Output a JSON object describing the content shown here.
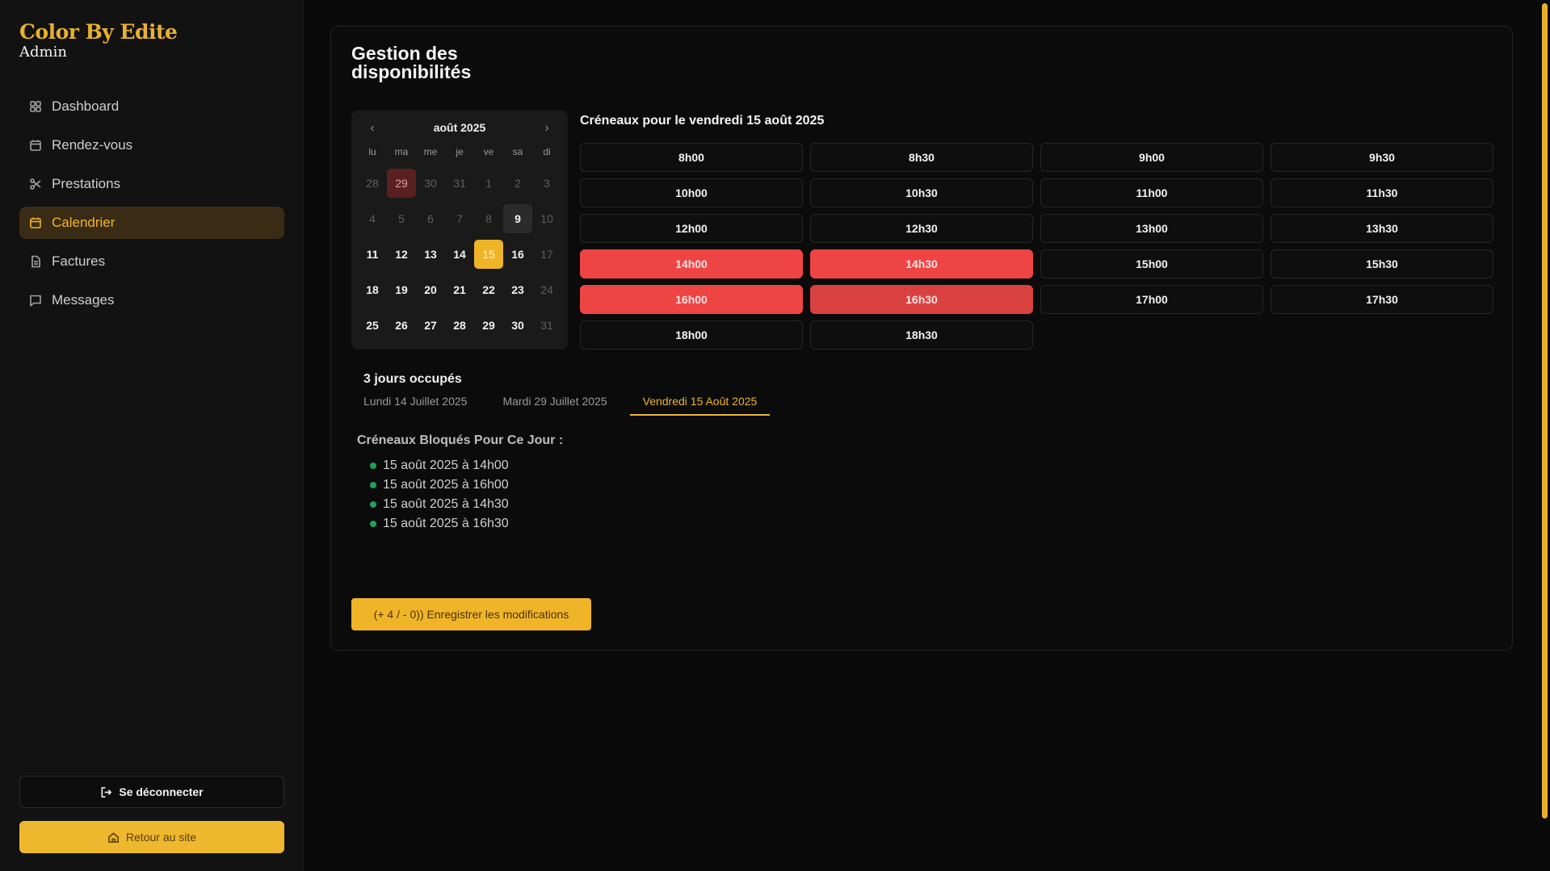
{
  "brand": {
    "title": "Color By Edite",
    "subtitle": "Admin"
  },
  "nav": {
    "items": [
      {
        "label": "Dashboard",
        "icon": "grid-icon"
      },
      {
        "label": "Rendez-vous",
        "icon": "calendar-icon"
      },
      {
        "label": "Prestations",
        "icon": "scissors-icon"
      },
      {
        "label": "Calendrier",
        "icon": "calendar-icon",
        "active": true
      },
      {
        "label": "Factures",
        "icon": "file-icon"
      },
      {
        "label": "Messages",
        "icon": "message-icon"
      }
    ]
  },
  "sidebar_actions": {
    "logout": "Se déconnecter",
    "home": "Retour au site"
  },
  "page": {
    "title": "Gestion des disponibilités"
  },
  "calendar": {
    "month": "août 2025",
    "prev": "‹",
    "next": "›",
    "weekdays": [
      "lu",
      "ma",
      "me",
      "je",
      "ve",
      "sa",
      "di"
    ],
    "days": [
      {
        "d": "28",
        "s": "muted"
      },
      {
        "d": "29",
        "s": "busy"
      },
      {
        "d": "30",
        "s": "muted"
      },
      {
        "d": "31",
        "s": "muted"
      },
      {
        "d": "1",
        "s": "muted"
      },
      {
        "d": "2",
        "s": "muted"
      },
      {
        "d": "3",
        "s": "muted"
      },
      {
        "d": "4",
        "s": "muted"
      },
      {
        "d": "5",
        "s": "muted"
      },
      {
        "d": "6",
        "s": "muted"
      },
      {
        "d": "7",
        "s": "muted"
      },
      {
        "d": "8",
        "s": "muted"
      },
      {
        "d": "9",
        "s": "hl"
      },
      {
        "d": "10",
        "s": "muted"
      },
      {
        "d": "11",
        "s": "norm"
      },
      {
        "d": "12",
        "s": "norm"
      },
      {
        "d": "13",
        "s": "norm"
      },
      {
        "d": "14",
        "s": "norm"
      },
      {
        "d": "15",
        "s": "sel"
      },
      {
        "d": "16",
        "s": "norm"
      },
      {
        "d": "17",
        "s": "muted"
      },
      {
        "d": "18",
        "s": "norm"
      },
      {
        "d": "19",
        "s": "norm"
      },
      {
        "d": "20",
        "s": "norm"
      },
      {
        "d": "21",
        "s": "norm"
      },
      {
        "d": "22",
        "s": "norm"
      },
      {
        "d": "23",
        "s": "norm"
      },
      {
        "d": "24",
        "s": "muted"
      },
      {
        "d": "25",
        "s": "norm"
      },
      {
        "d": "26",
        "s": "norm"
      },
      {
        "d": "27",
        "s": "norm"
      },
      {
        "d": "28",
        "s": "norm"
      },
      {
        "d": "29",
        "s": "norm"
      },
      {
        "d": "30",
        "s": "norm"
      },
      {
        "d": "31",
        "s": "muted"
      }
    ]
  },
  "slots": {
    "title": "Créneaux pour le vendredi 15 août 2025",
    "items": [
      {
        "t": "8h00",
        "s": ""
      },
      {
        "t": "8h30",
        "s": ""
      },
      {
        "t": "9h00",
        "s": ""
      },
      {
        "t": "9h30",
        "s": ""
      },
      {
        "t": "10h00",
        "s": ""
      },
      {
        "t": "10h30",
        "s": ""
      },
      {
        "t": "11h00",
        "s": ""
      },
      {
        "t": "11h30",
        "s": ""
      },
      {
        "t": "12h00",
        "s": ""
      },
      {
        "t": "12h30",
        "s": ""
      },
      {
        "t": "13h00",
        "s": ""
      },
      {
        "t": "13h30",
        "s": ""
      },
      {
        "t": "14h00",
        "s": "blocked"
      },
      {
        "t": "14h30",
        "s": "blocked"
      },
      {
        "t": "15h00",
        "s": ""
      },
      {
        "t": "15h30",
        "s": ""
      },
      {
        "t": "16h00",
        "s": "blocked"
      },
      {
        "t": "16h30",
        "s": "blocked dim"
      },
      {
        "t": "17h00",
        "s": ""
      },
      {
        "t": "17h30",
        "s": ""
      },
      {
        "t": "18h00",
        "s": ""
      },
      {
        "t": "18h30",
        "s": ""
      }
    ]
  },
  "occupied": {
    "title": "3 jours occupés",
    "tabs": [
      "Lundi 14 Juillet 2025",
      "Mardi 29 Juillet 2025",
      "Vendredi 15 Août 2025"
    ],
    "active_tab": 2,
    "blocked_title": "Créneaux Bloqués Pour Ce Jour :",
    "blocked": [
      "15 août 2025 à 14h00",
      "15 août 2025 à 16h00",
      "15 août 2025 à 14h30",
      "15 août 2025 à 16h30"
    ]
  },
  "save_button": "(+ 4 / - 0)) Enregistrer les modifications",
  "colors": {
    "accent": "#f0b429",
    "blocked": "#ef4444",
    "busy_day": "#5a1f1f",
    "status_dot": "#22a05a"
  }
}
